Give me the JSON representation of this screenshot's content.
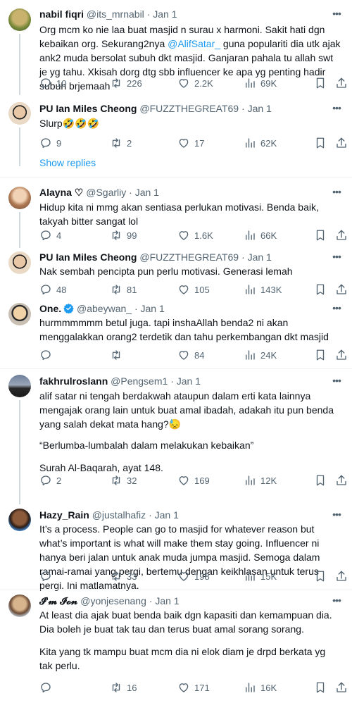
{
  "tweets": [
    {
      "name": "nabil fiqri",
      "handle": "@its_mrnabil",
      "date": "Jan 1",
      "paragraphs": [
        "Org mcm ko nie laa buat masjid n surau x harmoni. Sakit hati dgn kebaikan org. Sekurang2nya ",
        "@AlifSatar_",
        " guna populariti dia utk ajak ank2 muda bersolat subuh dkt masjid. Ganjaran pahala tu allah swt je yg tahu. Xkisah dorg dtg sbb influencer ke apa yg penting hadir subuh brjemaah"
      ],
      "replies": "10",
      "retweets": "226",
      "likes": "2.2K",
      "views": "69K"
    },
    {
      "name": "PU Ian Miles Cheong",
      "handle": "@FUZZTHEGREAT69",
      "date": "Jan 1",
      "paragraphs": [
        "Slurp🤣🤣🤣"
      ],
      "replies": "9",
      "retweets": "2",
      "likes": "17",
      "views": "62K"
    },
    {
      "name": "Alayna ♡",
      "handle": "@Sgarliy",
      "date": "Jan 1",
      "paragraphs": [
        "Hidup kita ni mmg akan sentiasa perlukan motivasi. Benda baik, takyah bitter sangat lol"
      ],
      "replies": "4",
      "retweets": "99",
      "likes": "1.6K",
      "views": "66K"
    },
    {
      "name": "PU Ian Miles Cheong",
      "handle": "@FUZZTHEGREAT69",
      "date": "Jan 1",
      "paragraphs": [
        "Nak sembah pencipta pun perlu motivasi. Generasi lemah"
      ],
      "replies": "48",
      "retweets": "81",
      "likes": "105",
      "views": "143K"
    },
    {
      "name": "One.",
      "handle": "@abeywan_",
      "date": "Jan 1",
      "paragraphs": [
        "hurmmmmmm betul juga. tapi inshaAllah benda2 ni akan menggalakkan orang2 terdetik dan tahu perkembangan dkt masjid"
      ],
      "replies": "",
      "retweets": "",
      "likes": "84",
      "views": "24K"
    },
    {
      "name": "fakhrulroslann",
      "handle": "@Pengsem1",
      "date": "Jan 1",
      "paragraphs": [
        "alif satar ni tengah berdakwah ataupun dalam erti kata lainnya mengajak orang lain untuk buat amal ibadah, adakah itu pun benda yang salah dekat mata hang?😓",
        "“Berlumba-lumbalah dalam melakukan kebaikan”",
        "Surah Al-Baqarah, ayat 148."
      ],
      "replies": "2",
      "retweets": "32",
      "likes": "169",
      "views": "12K"
    },
    {
      "name": "Hazy_Rain",
      "handle": "@justalhafiz",
      "date": "Jan 1",
      "paragraphs": [
        "It’s a process. People can go to masjid for whatever reason but what’s important is what will make them stay going. Influencer ni hanya beri jalan untuk anak muda jumpa masjid. Semoga dalam ramai-ramai yang pergi, bertemu dengan keikhlasan untuk terus pergi. Ini matlamatnya."
      ],
      "replies": "",
      "retweets": "33",
      "likes": "198",
      "views": "15K"
    },
    {
      "name": "𝓘'𝓶 𝓘𝓸𝓷",
      "handle": "@yonjesenang",
      "date": "Jan 1",
      "paragraphs": [
        "At least dia ajak buat benda baik dgn kapasiti dan kemampuan dia. Dia boleh je buat tak tau dan terus buat amal sorang sorang.",
        "Kita yang tk mampu buat mcm dia ni elok diam je drpd berkata yg tak perlu."
      ],
      "replies": "",
      "retweets": "16",
      "likes": "171",
      "views": "16K"
    }
  ],
  "show_replies_label": "Show replies",
  "dot": "·",
  "icons": {
    "reply": "reply-icon",
    "retweet": "retweet-icon",
    "like": "heart-icon",
    "views": "views-icon",
    "bookmark": "bookmark-icon",
    "share": "share-icon",
    "more": "more-icon",
    "verified": "verified-badge-icon"
  },
  "colors": {
    "link": "#1d9bf0",
    "text": "#0f1419",
    "muted": "#536471",
    "divider": "#eff3f4",
    "verified": "#1d9bf0"
  }
}
